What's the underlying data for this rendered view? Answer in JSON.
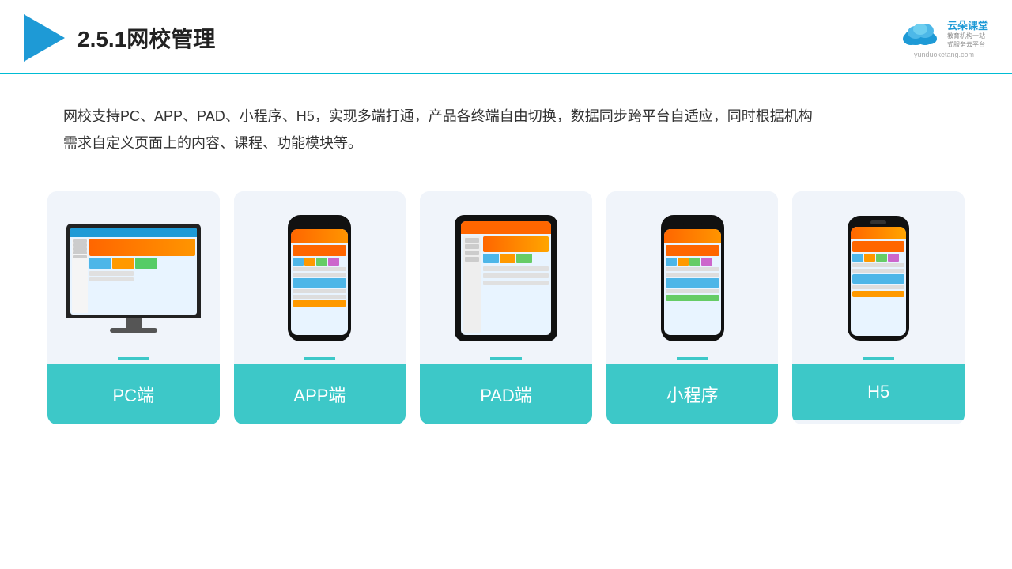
{
  "header": {
    "title": "2.5.1网校管理",
    "brand": {
      "name": "云朵课堂",
      "sub_line1": "教育机构一站",
      "sub_line2": "式服务云平台",
      "url": "yunduoketang.com"
    }
  },
  "description": {
    "text": "网校支持PC、APP、PAD、小程序、H5，实现多端打通，产品各终端自由切换，数据同步跨平台自适应，同时根据机构需求自定义页面上的内容、课程、功能模块等。"
  },
  "cards": [
    {
      "id": "pc",
      "label": "PC端"
    },
    {
      "id": "app",
      "label": "APP端"
    },
    {
      "id": "pad",
      "label": "PAD端"
    },
    {
      "id": "miniapp",
      "label": "小程序"
    },
    {
      "id": "h5",
      "label": "H5"
    }
  ],
  "colors": {
    "accent": "#3dc8c8",
    "header_line": "#00bcd4",
    "title_blue": "#1e9ad6"
  }
}
